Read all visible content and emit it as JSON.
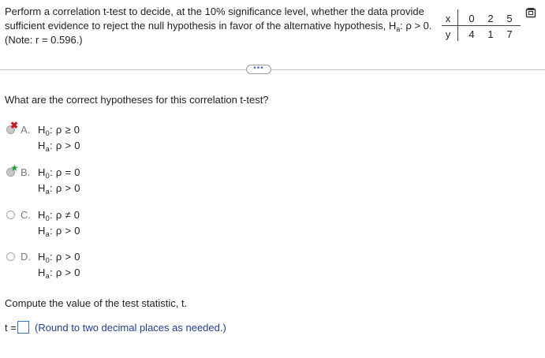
{
  "question": {
    "line1": "Perform a correlation t-test to decide, at the 10% significance level, whether the data provide",
    "line2_prefix": "sufficient evidence to reject the null hypothesis in favor of the alternative hypothesis, H",
    "line2_sub": "a",
    "line2_suffix": ": ρ > 0.",
    "line3": "(Note: r = 0.596.)"
  },
  "table": {
    "x_label": "x",
    "y_label": "y",
    "x_values": [
      "0",
      "2",
      "5"
    ],
    "y_values": [
      "4",
      "1",
      "7"
    ]
  },
  "more_button": "•••",
  "part1": {
    "prompt": "What are the correct hypotheses for this correlation t-test?",
    "options": [
      {
        "letter": "A.",
        "h0": "ρ ≥ 0",
        "ha": "ρ > 0",
        "state": "incorrect"
      },
      {
        "letter": "B.",
        "h0": "ρ = 0",
        "ha": "ρ > 0",
        "state": "correct"
      },
      {
        "letter": "C.",
        "h0": "ρ ≠ 0",
        "ha": "ρ > 0",
        "state": "none"
      },
      {
        "letter": "D.",
        "h0": "ρ > 0",
        "ha": "ρ > 0",
        "state": "none"
      }
    ],
    "h0_sub": "0",
    "ha_sub": "a",
    "h_letter": "H"
  },
  "part2": {
    "prompt": "Compute the value of the test statistic, t.",
    "answer_prefix": "t =",
    "answer_value": "",
    "note": "(Round to two decimal places as needed.)"
  },
  "marks": {
    "incorrect": "✖",
    "correct": "★"
  },
  "colors": {
    "incorrect": "#d1141b",
    "correct": "#1aa33a",
    "answer_border": "#3a6fd8",
    "note_text": "#1c3f9e"
  },
  "icons": {
    "copy": "copy-icon"
  }
}
